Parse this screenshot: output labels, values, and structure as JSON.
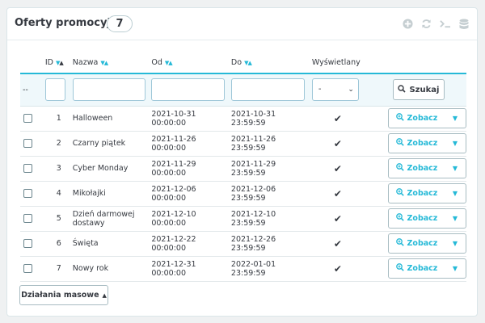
{
  "panel": {
    "title": "Oferty promocyjne",
    "count": "7",
    "tool_icons": [
      "add-icon",
      "refresh-icon",
      "terminal-icon",
      "database-icon"
    ]
  },
  "columns": {
    "id": "ID",
    "name": "Nazwa",
    "from": "Od",
    "to": "Do",
    "displayed": "Wyświetlany"
  },
  "filters": {
    "placeholder_label": "--",
    "displayed_value": "-",
    "search_label": "Szukaj"
  },
  "rows": [
    {
      "id": "1",
      "name": "Halloween",
      "from": "2021-10-31 00:00:00",
      "to": "2021-10-31 23:59:59"
    },
    {
      "id": "2",
      "name": "Czarny piątek",
      "from": "2021-11-26 00:00:00",
      "to": "2021-11-26 23:59:59"
    },
    {
      "id": "3",
      "name": "Cyber Monday",
      "from": "2021-11-29 00:00:00",
      "to": "2021-11-29 23:59:59"
    },
    {
      "id": "4",
      "name": "Mikołajki",
      "from": "2021-12-06 00:00:00",
      "to": "2021-12-06 23:59:59"
    },
    {
      "id": "5",
      "name": "Dzień darmowej dostawy",
      "from": "2021-12-10 00:00:00",
      "to": "2021-12-10 23:59:59"
    },
    {
      "id": "6",
      "name": "Święta",
      "from": "2021-12-22 00:00:00",
      "to": "2021-12-26 23:59:59"
    },
    {
      "id": "7",
      "name": "Nowy rok",
      "from": "2021-12-31 00:00:00",
      "to": "2022-01-01 23:59:59"
    }
  ],
  "row_action_label": "Zobacz",
  "bulk_actions_label": "Działania masowe",
  "colors": {
    "accent": "#25b9d7",
    "success": "#70b580",
    "text": "#363a41"
  }
}
